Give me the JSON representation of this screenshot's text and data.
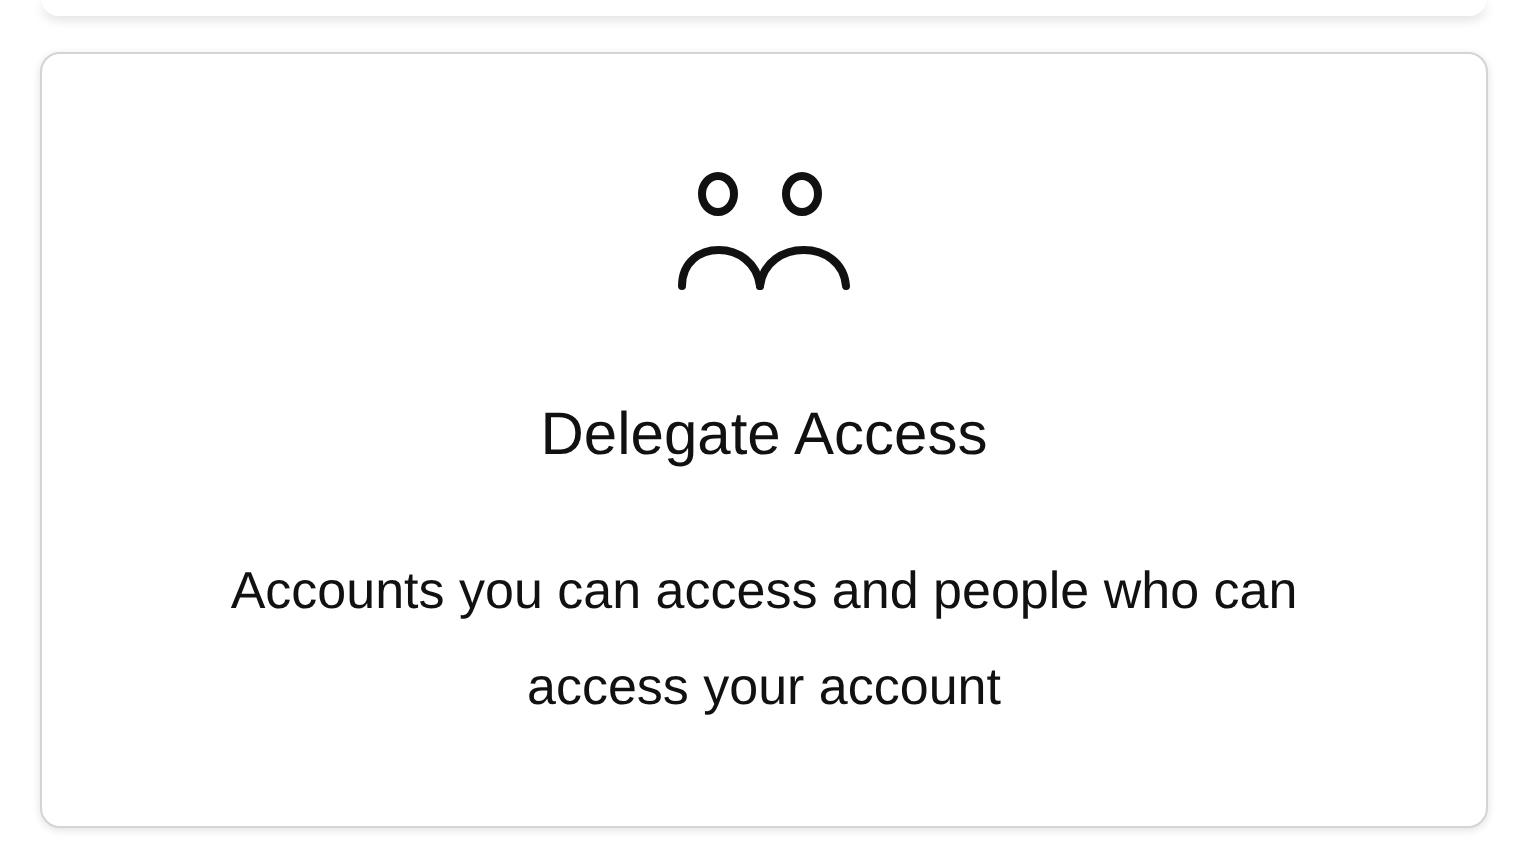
{
  "card": {
    "title": "Delegate Access",
    "description": "Accounts you can access and people who can access your account"
  }
}
